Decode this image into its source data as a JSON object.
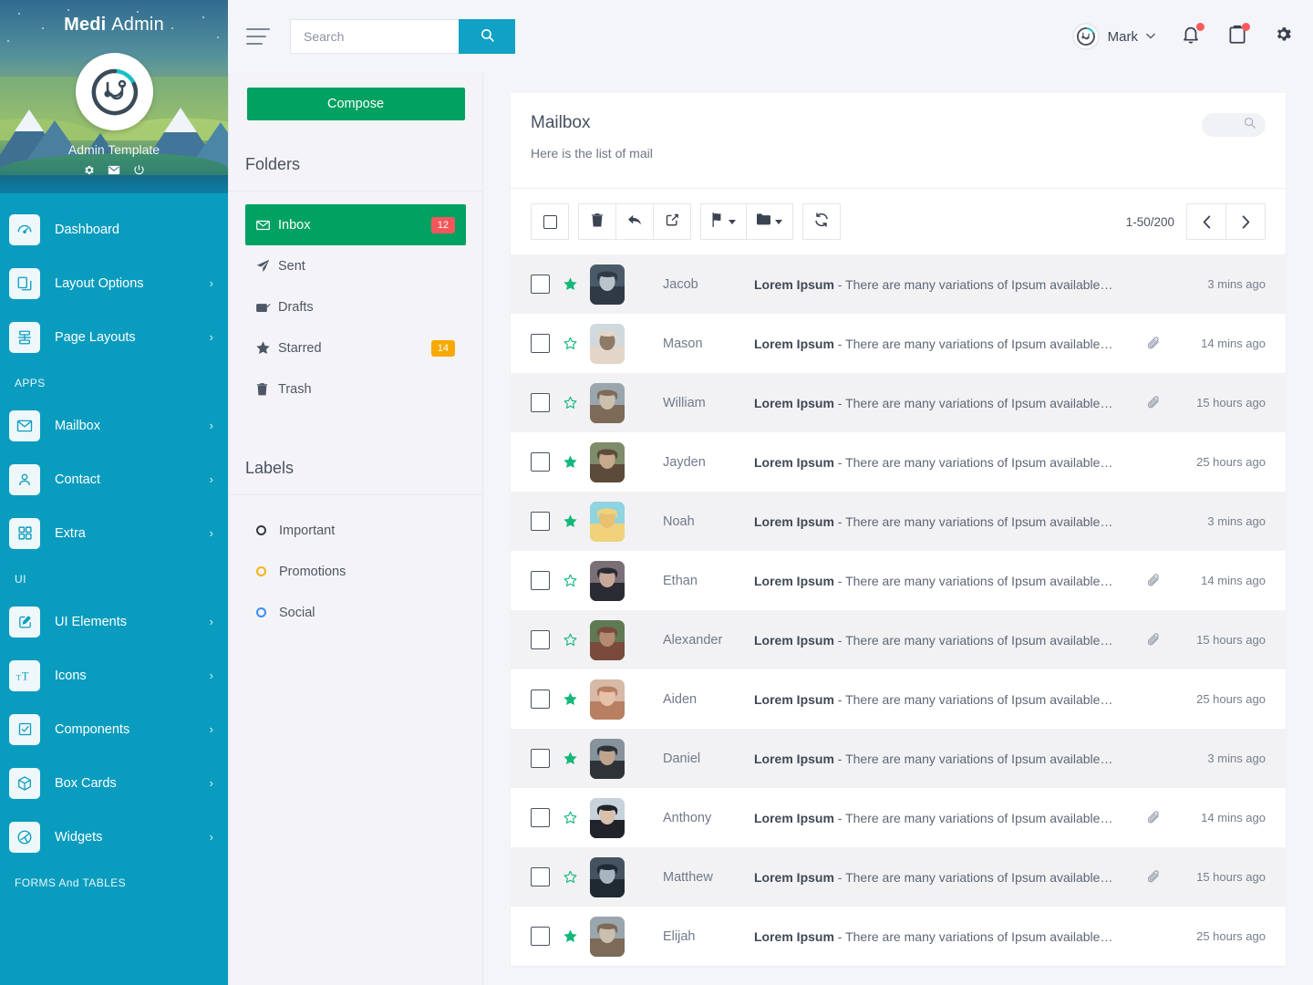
{
  "brand": {
    "bold": "Medi",
    "light": "Admin",
    "template_name": "Admin Template"
  },
  "sidebar": {
    "items": [
      {
        "label": "Dashboard",
        "icon": "dashboard-icon",
        "caret": false
      },
      {
        "label": "Layout Options",
        "icon": "layers-icon",
        "caret": true
      },
      {
        "label": "Page Layouts",
        "icon": "page-layout-icon",
        "caret": true
      },
      {
        "label": "APPS",
        "header": true
      },
      {
        "label": "Mailbox",
        "icon": "envelope-icon",
        "caret": true
      },
      {
        "label": "Contact",
        "icon": "user-icon",
        "caret": true
      },
      {
        "label": "Extra",
        "icon": "grid-icon",
        "caret": true
      },
      {
        "label": "UI",
        "header": true
      },
      {
        "label": "UI Elements",
        "icon": "pencil-square-icon",
        "caret": true
      },
      {
        "label": "Icons",
        "icon": "typography-icon",
        "caret": true
      },
      {
        "label": "Components",
        "icon": "checkbox-icon",
        "caret": true
      },
      {
        "label": "Box Cards",
        "icon": "cube-icon",
        "caret": true
      },
      {
        "label": "Widgets",
        "icon": "widgets-icon",
        "caret": true
      },
      {
        "label": "FORMS And TABLES",
        "header": true
      }
    ],
    "caret_glyph": "›"
  },
  "topbar": {
    "search": {
      "placeholder": "Search",
      "value": ""
    },
    "user": {
      "name": "Mark",
      "chevron": "⌄"
    },
    "icons": [
      "bell-icon",
      "clipboard-icon",
      "gear-icon"
    ]
  },
  "folders_panel": {
    "compose_label": "Compose",
    "folders_title": "Folders",
    "labels_title": "Labels",
    "folders": [
      {
        "label": "Inbox",
        "icon": "envelope-icon",
        "badge": "12",
        "badge_color": "red",
        "active": true
      },
      {
        "label": "Sent",
        "icon": "paper-plane-icon",
        "badge": "",
        "badge_color": "",
        "active": false
      },
      {
        "label": "Drafts",
        "icon": "draft-icon",
        "badge": "",
        "badge_color": "",
        "active": false
      },
      {
        "label": "Starred",
        "icon": "star-icon",
        "badge": "14",
        "badge_color": "orange",
        "active": false
      },
      {
        "label": "Trash",
        "icon": "trash-icon",
        "badge": "",
        "badge_color": "",
        "active": false
      }
    ],
    "labels": [
      {
        "label": "Important",
        "color": "#333a44"
      },
      {
        "label": "Promotions",
        "color": "#f5b21a"
      },
      {
        "label": "Social",
        "color": "#3d8ef8"
      }
    ]
  },
  "mailbox": {
    "title": "Mailbox",
    "subtitle": "Here is the list of mail",
    "search_icon": "search-icon",
    "toolbar": {
      "select_all": "select-all-checkbox",
      "buttons": [
        "trash-icon",
        "reply-icon",
        "forward-icon",
        "flag-icon",
        "folder-icon",
        "refresh-icon"
      ],
      "pagination_text": "1-50/200",
      "prev": "‹",
      "next": "›"
    },
    "rows": [
      {
        "name": "Jacob",
        "subject_bold": "Lorem Ipsum",
        "subject": " - There are many variations of Ipsum available…",
        "time": "3 mins ago",
        "starred": true,
        "attachment": false,
        "alt": true
      },
      {
        "name": "Mason",
        "subject_bold": "Lorem Ipsum",
        "subject": " - There are many variations of Ipsum available…",
        "time": "14 mins ago",
        "starred": false,
        "attachment": true,
        "alt": false
      },
      {
        "name": "William",
        "subject_bold": "Lorem Ipsum",
        "subject": " - There are many variations of Ipsum available…",
        "time": "15 hours ago",
        "starred": false,
        "attachment": true,
        "alt": true
      },
      {
        "name": "Jayden",
        "subject_bold": "Lorem Ipsum",
        "subject": " - There are many variations of Ipsum available…",
        "time": "25 hours ago",
        "starred": true,
        "attachment": false,
        "alt": false
      },
      {
        "name": "Noah",
        "subject_bold": "Lorem Ipsum",
        "subject": " - There are many variations of Ipsum available…",
        "time": "3 mins ago",
        "starred": true,
        "attachment": false,
        "alt": true
      },
      {
        "name": "Ethan",
        "subject_bold": "Lorem Ipsum",
        "subject": " - There are many variations of Ipsum available…",
        "time": "14 mins ago",
        "starred": false,
        "attachment": true,
        "alt": false
      },
      {
        "name": "Alexander",
        "subject_bold": "Lorem Ipsum",
        "subject": " - There are many variations of Ipsum available…",
        "time": "15 hours ago",
        "starred": false,
        "attachment": true,
        "alt": true
      },
      {
        "name": "Aiden",
        "subject_bold": "Lorem Ipsum",
        "subject": " - There are many variations of Ipsum available…",
        "time": "25 hours ago",
        "starred": true,
        "attachment": false,
        "alt": false
      },
      {
        "name": "Daniel",
        "subject_bold": "Lorem Ipsum",
        "subject": " - There are many variations of Ipsum available…",
        "time": "3 mins ago",
        "starred": true,
        "attachment": false,
        "alt": true
      },
      {
        "name": "Anthony",
        "subject_bold": "Lorem Ipsum",
        "subject": " - There are many variations of Ipsum available…",
        "time": "14 mins ago",
        "starred": false,
        "attachment": true,
        "alt": false
      },
      {
        "name": "Matthew",
        "subject_bold": "Lorem Ipsum",
        "subject": " - There are many variations of Ipsum available…",
        "time": "15 hours ago",
        "starred": false,
        "attachment": true,
        "alt": true
      },
      {
        "name": "Elijah",
        "subject_bold": "Lorem Ipsum",
        "subject": " - There are many variations of Ipsum available…",
        "time": "25 hours ago",
        "starred": true,
        "attachment": false,
        "alt": false
      }
    ]
  },
  "colors": {
    "sidebar": "#099cbf",
    "accent_green": "#00a161",
    "badge_red": "#f5565c",
    "badge_orange": "#f8a900",
    "star_green": "#14b87a",
    "page_bg": "#f4f5f9"
  }
}
